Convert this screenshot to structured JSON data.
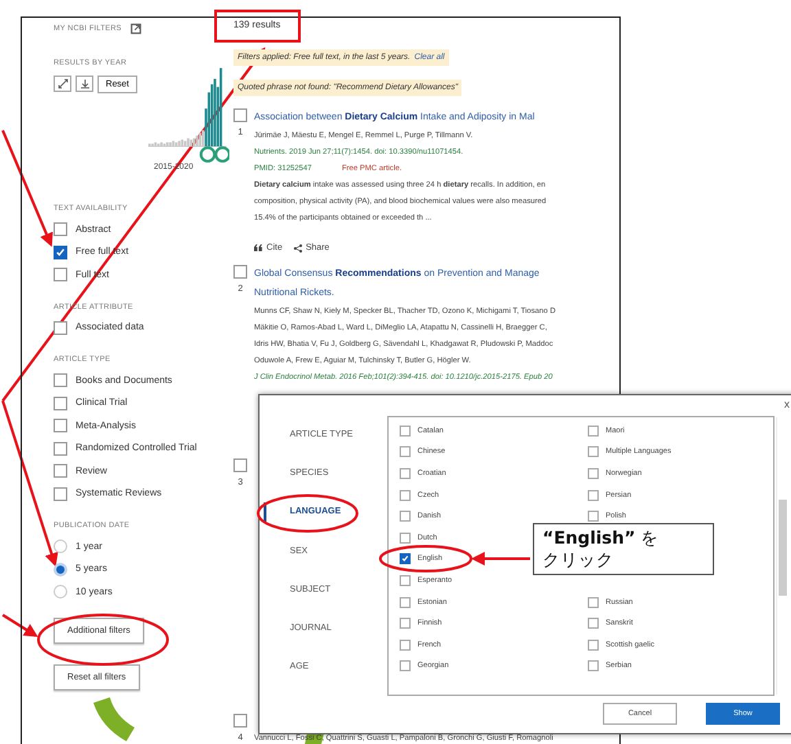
{
  "sidebar": {
    "my_filters": "MY NCBI FILTERS",
    "results_by_year": {
      "title": "RESULTS BY YEAR",
      "reset": "Reset",
      "range_label": "2015-2020"
    },
    "groups": [
      {
        "title": "TEXT AVAILABILITY",
        "kind": "checkbox",
        "options": [
          {
            "label": "Abstract",
            "checked": false
          },
          {
            "label": "Free full text",
            "checked": true
          },
          {
            "label": "Full text",
            "checked": false
          }
        ]
      },
      {
        "title": "ARTICLE ATTRIBUTE",
        "kind": "checkbox",
        "options": [
          {
            "label": "Associated data",
            "checked": false
          }
        ]
      },
      {
        "title": "ARTICLE TYPE",
        "kind": "checkbox",
        "options": [
          {
            "label": "Books and Documents",
            "checked": false
          },
          {
            "label": "Clinical Trial",
            "checked": false
          },
          {
            "label": "Meta-Analysis",
            "checked": false
          },
          {
            "label": "Randomized Controlled Trial",
            "checked": false
          },
          {
            "label": "Review",
            "checked": false
          },
          {
            "label": "Systematic Reviews",
            "checked": false
          }
        ]
      },
      {
        "title": "PUBLICATION DATE",
        "kind": "radio",
        "options": [
          {
            "label": "1 year",
            "selected": false
          },
          {
            "label": "5 years",
            "selected": true
          },
          {
            "label": "10 years",
            "selected": false
          }
        ]
      }
    ],
    "buttons": [
      "Additional filters",
      "Reset all filters"
    ]
  },
  "results": {
    "count": "139 results",
    "notices": [
      {
        "text": "Filters applied: Free full text, in the last 5 years.",
        "link": "Clear all"
      },
      {
        "text": "Quoted phrase not found: \"Recommend Dietary Allowances\""
      }
    ],
    "items": [
      {
        "number": "1",
        "checked": false,
        "title_lines": [
          "Association between **Dietary Calcium** Intake and Adiposity in Mal"
        ],
        "authors": [
          "Jürimäe J, Mäestu E, Mengel E, Remmel L, Purge P, Tillmann V."
        ],
        "citation": "Nutrients. 2019 Jun 27;11(7):1454. doi: 10.3390/nu11071454.",
        "pmid": "PMID: 31252547",
        "free": "Free PMC article.",
        "snippet": [
          "**Dietary calcium** intake was assessed using three 24 h **dietary** recalls. In addition, en",
          "composition, physical activity (PA), and blood biochemical values were also measured",
          "15.4% of the participants obtained or exceeded th ..."
        ],
        "actions": [
          "Cite",
          "Share"
        ]
      },
      {
        "number": "2",
        "checked": false,
        "title_lines": [
          "Global Consensus **Recommendations** on Prevention and Manage",
          "Nutritional Rickets."
        ],
        "authors": [
          "Munns CF, Shaw N, Kiely M, Specker BL, Thacher TD, Ozono K, Michigami T, Tiosano D",
          "Mäkitie O, Ramos-Abad L, Ward L, DiMeglio LA, Atapattu N, Cassinelli H, Braegger C,",
          "Idris HW, Bhatia V, Fu J, Goldberg G, Sävendahl L, Khadgawat R, Pludowski P, Maddoc",
          "Oduwole A, Frew E, Aguiar M, Tulchinsky T, Butler G, Högler W."
        ],
        "journal_citation": "J Clin Endocrinol Metab. 2016 Feb;101(2):394-415. doi: 10.1210/jc.2015-2175. Epub 20"
      },
      {
        "number": "3",
        "checked": false
      },
      {
        "number": "4",
        "checked": false,
        "authors": [
          "Vannucci L, Fossi C, Quattrini S, Guasti L, Pampaloni B, Gronchi G, Giusti F, Romagnoli"
        ]
      }
    ]
  },
  "dialog": {
    "nav": [
      {
        "label": "ARTICLE TYPE",
        "selected": false
      },
      {
        "label": "SPECIES",
        "selected": false
      },
      {
        "label": "LANGUAGE",
        "selected": true
      },
      {
        "label": "SEX",
        "selected": false
      },
      {
        "label": "SUBJECT",
        "selected": false
      },
      {
        "label": "JOURNAL",
        "selected": false
      },
      {
        "label": "AGE",
        "selected": false
      }
    ],
    "columns": [
      [
        {
          "label": "Catalan",
          "checked": false
        },
        {
          "label": "Chinese",
          "checked": false
        },
        {
          "label": "Croatian",
          "checked": false
        },
        {
          "label": "Czech",
          "checked": false
        },
        {
          "label": "Danish",
          "checked": false
        },
        {
          "label": "Dutch",
          "checked": false
        },
        {
          "label": "English",
          "checked": true
        },
        {
          "label": "Esperanto",
          "checked": false
        },
        {
          "label": "Estonian",
          "checked": false
        },
        {
          "label": "Finnish",
          "checked": false
        },
        {
          "label": "French",
          "checked": false
        },
        {
          "label": "Georgian",
          "checked": false
        }
      ],
      [
        {
          "label": "Maori",
          "checked": false
        },
        {
          "label": "Multiple Languages",
          "checked": false
        },
        {
          "label": "Norwegian",
          "checked": false
        },
        {
          "label": "Persian",
          "checked": false
        },
        {
          "label": "Polish",
          "checked": false
        },
        null,
        null,
        null,
        {
          "label": "Russian",
          "checked": false
        },
        {
          "label": "Sanskrit",
          "checked": false
        },
        {
          "label": "Scottish gaelic",
          "checked": false
        },
        {
          "label": "Serbian",
          "checked": false
        }
      ]
    ],
    "buttons": [
      {
        "label": "Cancel",
        "kind": "secondary"
      },
      {
        "label": "Show",
        "kind": "primary"
      }
    ],
    "close": "x"
  },
  "callout": {
    "lines": [
      "**“English”** を",
      "クリック"
    ]
  }
}
